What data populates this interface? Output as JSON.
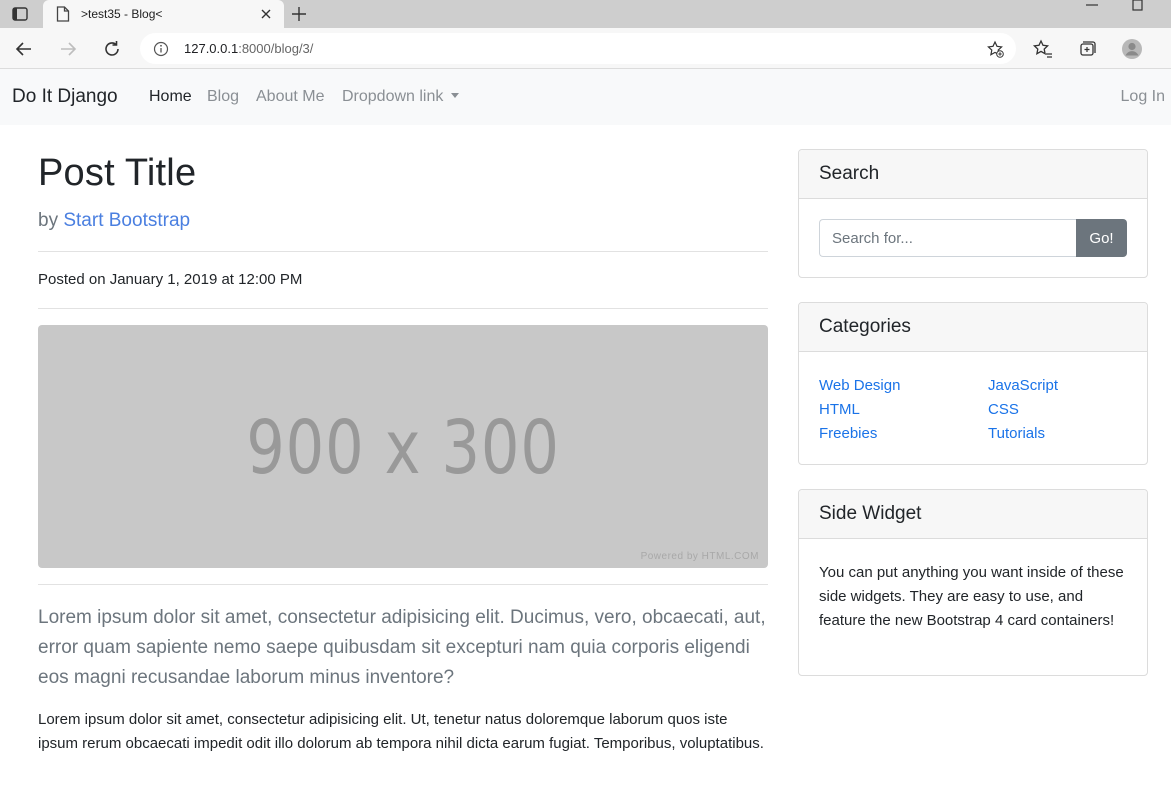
{
  "browser": {
    "tab_title": ">test35 - Blog<",
    "url_host": "127.0.0.1",
    "url_path": ":8000/blog/3/"
  },
  "navbar": {
    "brand": "Do It Django",
    "links": [
      {
        "label": "Home"
      },
      {
        "label": "Blog"
      },
      {
        "label": "About Me"
      },
      {
        "label": "Dropdown link"
      }
    ],
    "login": "Log In"
  },
  "post": {
    "title": "Post Title",
    "by_prefix": "by",
    "author": "Start Bootstrap",
    "posted": "Posted on January 1, 2019 at 12:00 PM",
    "image_text": "900 x 300",
    "image_credit": "Powered by HTML.COM",
    "lead": "Lorem ipsum dolor sit amet, consectetur adipisicing elit. Ducimus, vero, obcaecati, aut, error quam sapiente nemo saepe quibusdam sit excepturi nam quia corporis eligendi eos magni recusandae laborum minus inventore?",
    "paragraph": "Lorem ipsum dolor sit amet, consectetur adipisicing elit. Ut, tenetur natus doloremque laborum quos iste ipsum rerum obcaecati impedit odit illo dolorum ab tempora nihil dicta earum fugiat. Temporibus, voluptatibus."
  },
  "sidebar": {
    "search": {
      "title": "Search",
      "placeholder": "Search for...",
      "button": "Go!"
    },
    "categories": {
      "title": "Categories",
      "items": [
        "Web Design",
        "JavaScript",
        "HTML",
        "CSS",
        "Freebies",
        "Tutorials"
      ]
    },
    "widget": {
      "title": "Side Widget",
      "text": "You can put anything you want inside of these side widgets. They are easy to use, and feature the new Bootstrap 4 card containers!"
    }
  }
}
